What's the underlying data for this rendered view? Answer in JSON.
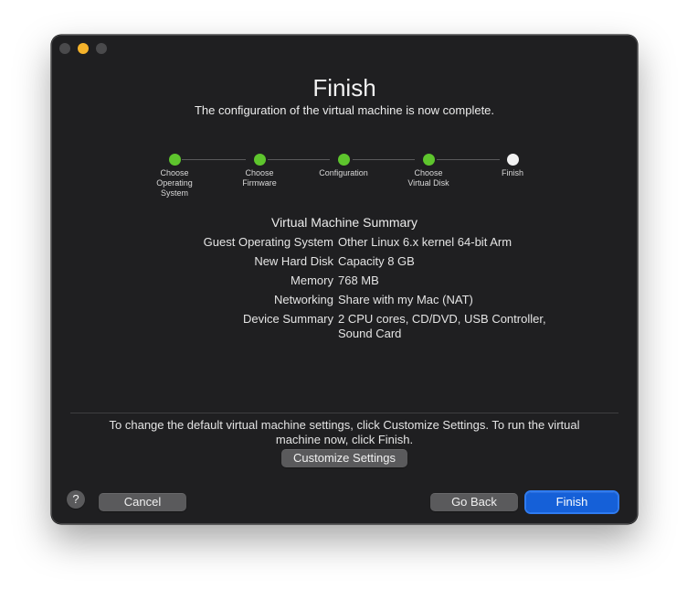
{
  "window": {
    "title": "Finish",
    "subtitle": "The configuration of the virtual machine is now complete."
  },
  "steps": [
    {
      "label": "Choose Operating System",
      "status": "done"
    },
    {
      "label": "Choose Firmware",
      "status": "done"
    },
    {
      "label": "Configuration",
      "status": "done"
    },
    {
      "label": "Choose Virtual Disk",
      "status": "done"
    },
    {
      "label": "Finish",
      "status": "current"
    }
  ],
  "summary": {
    "title": "Virtual Machine Summary",
    "rows": [
      {
        "key": "Guest Operating System",
        "value": "Other Linux 6.x kernel 64-bit Arm"
      },
      {
        "key": "New Hard Disk",
        "value": "Capacity 8 GB"
      },
      {
        "key": "Memory",
        "value": "768 MB"
      },
      {
        "key": "Networking",
        "value": "Share with my Mac (NAT)"
      },
      {
        "key": "Device Summary",
        "value": "2 CPU cores, CD/DVD, USB Controller, Sound Card"
      }
    ]
  },
  "hint": "To change the default virtual machine settings, click Customize Settings. To run the virtual machine now, click Finish.",
  "buttons": {
    "customize": "Customize Settings",
    "cancel": "Cancel",
    "go_back": "Go Back",
    "finish": "Finish",
    "help": "?"
  },
  "colors": {
    "step_done": "#5ec52d",
    "step_current": "#f2f2f2",
    "primary_button": "#1560d8",
    "window_bg": "#1f1f21"
  }
}
